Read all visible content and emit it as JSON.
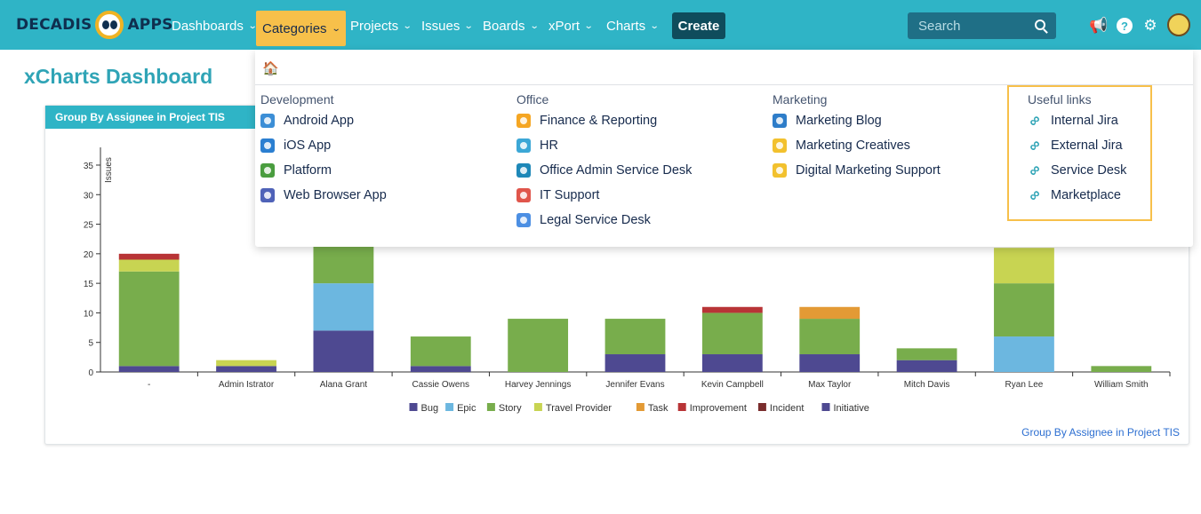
{
  "topbar": {
    "logo_left": "DECADIS",
    "logo_right": "APPS",
    "nav": [
      {
        "label": "Dashboards"
      },
      {
        "label": "Categories"
      },
      {
        "label": "Projects"
      },
      {
        "label": "Issues"
      },
      {
        "label": "Boards"
      },
      {
        "label": "xPort"
      },
      {
        "label": "Charts"
      }
    ],
    "create_label": "Create",
    "search_placeholder": "Search",
    "icons": [
      "megaphone-icon",
      "help-icon",
      "gear-icon",
      "avatar"
    ]
  },
  "page": {
    "title": "xCharts Dashboard"
  },
  "categories_menu": {
    "columns": [
      {
        "heading": "Development",
        "items": [
          {
            "label": "Android App",
            "color": "#3c8ed6"
          },
          {
            "label": "iOS App",
            "color": "#2b7fd1"
          },
          {
            "label": "Platform",
            "color": "#4a9d3f"
          },
          {
            "label": "Web Browser App",
            "color": "#4f62b8"
          }
        ]
      },
      {
        "heading": "Office",
        "items": [
          {
            "label": "Finance & Reporting",
            "color": "#f5a623"
          },
          {
            "label": "HR",
            "color": "#3ca7d6"
          },
          {
            "label": "Office Admin Service Desk",
            "color": "#1e88b8"
          },
          {
            "label": "IT Support",
            "color": "#e0554b"
          },
          {
            "label": "Legal Service Desk",
            "color": "#4c8fe3"
          }
        ]
      },
      {
        "heading": "Marketing",
        "items": [
          {
            "label": "Marketing Blog",
            "color": "#2e7dc9"
          },
          {
            "label": "Marketing Creatives",
            "color": "#f2c12e"
          },
          {
            "label": "Digital Marketing Support",
            "color": "#f2c12e"
          }
        ]
      },
      {
        "heading": "Useful links",
        "items": [
          {
            "label": "Internal Jira"
          },
          {
            "label": "External Jira"
          },
          {
            "label": "Service Desk"
          },
          {
            "label": "Marketplace"
          }
        ]
      }
    ]
  },
  "panel": {
    "title": "Group By Assignee in Project TIS",
    "footer_link": "Group By Assignee in Project TIS"
  },
  "chart_data": {
    "type": "bar",
    "stacked": true,
    "ylabel": "Issues",
    "ylim": [
      0,
      38
    ],
    "yticks": [
      0,
      5,
      10,
      15,
      20,
      25,
      30,
      35
    ],
    "categories": [
      "-",
      "Admin Istrator",
      "Alana Grant",
      "Cassie Owens",
      "Harvey Jennings",
      "Jennifer Evans",
      "Kevin Campbell",
      "Max Taylor",
      "Mitch Davis",
      "Ryan Lee",
      "William Smith"
    ],
    "series": [
      {
        "name": "Bug",
        "color": "#4e4991",
        "values": [
          1,
          1,
          7,
          1,
          0,
          3,
          3,
          3,
          2,
          0,
          0
        ]
      },
      {
        "name": "Epic",
        "color": "#6cb7e0",
        "values": [
          0,
          0,
          8,
          0,
          0,
          0,
          0,
          0,
          0,
          6,
          0
        ]
      },
      {
        "name": "Story",
        "color": "#78ad4c",
        "values": [
          16,
          0,
          8,
          5,
          9,
          6,
          7,
          6,
          2,
          9,
          1
        ]
      },
      {
        "name": "Travel Provider",
        "color": "#c8d452",
        "values": [
          2,
          1,
          0,
          0,
          0,
          0,
          0,
          0,
          0,
          6,
          0
        ]
      },
      {
        "name": "Task",
        "color": "#e39a35",
        "values": [
          0,
          0,
          0,
          0,
          0,
          0,
          0,
          2,
          0,
          0,
          0
        ]
      },
      {
        "name": "Improvement",
        "color": "#b83436",
        "values": [
          1,
          0,
          0,
          0,
          0,
          0,
          1,
          0,
          0,
          0,
          0
        ]
      },
      {
        "name": "Incident",
        "color": "#7a2d2d",
        "values": [
          0,
          0,
          0,
          0,
          0,
          0,
          0,
          0,
          0,
          0,
          0
        ]
      },
      {
        "name": "Initiative",
        "color": "#4e4991",
        "values": [
          0,
          0,
          0,
          0,
          0,
          0,
          0,
          0,
          0,
          0,
          0
        ]
      }
    ],
    "legend_position": "bottom-center"
  }
}
